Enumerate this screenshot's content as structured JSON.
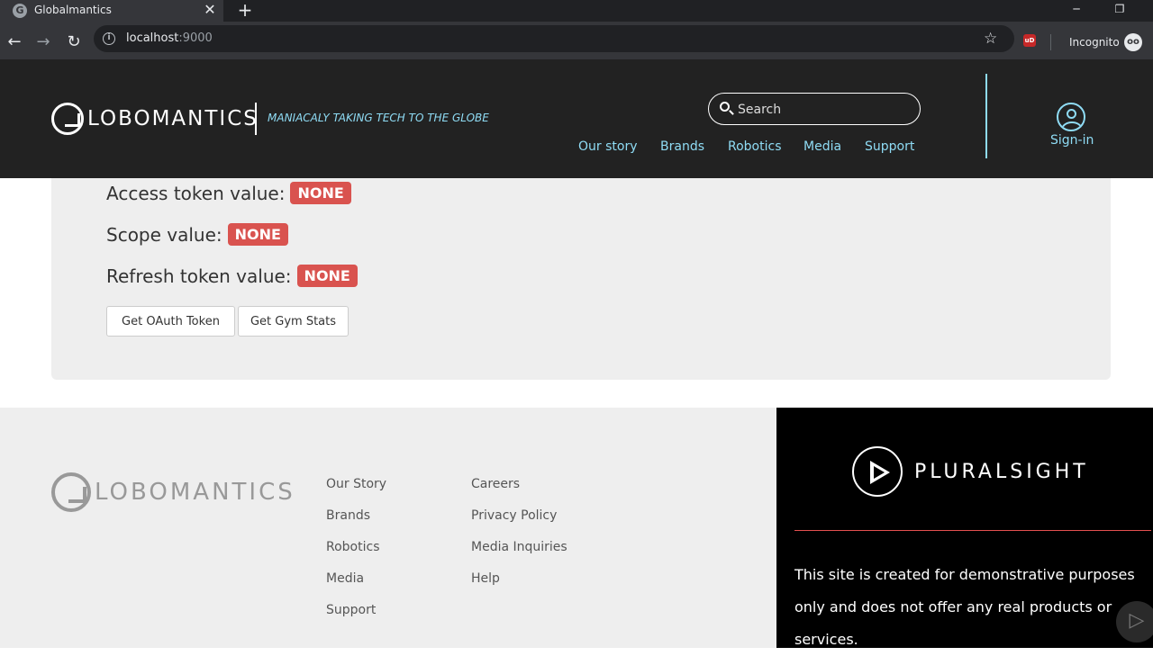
{
  "browser": {
    "tab_title": "Globalmantics",
    "tab_close": "✕",
    "new_tab": "+",
    "url_host": "localhost",
    "url_port": ":9000",
    "incognito_label": "Incognito",
    "ext_label": "uD"
  },
  "header": {
    "logo_text": "LOBOMANTICS",
    "tagline": "MANIACALY TAKING TECH TO THE GLOBE",
    "search_placeholder": "Search",
    "nav": [
      "Our story",
      "Brands",
      "Robotics",
      "Media",
      "Support"
    ],
    "signin": "Sign-in"
  },
  "panel": {
    "rows": [
      {
        "label": "Access token value:",
        "badge": "NONE"
      },
      {
        "label": "Scope value:",
        "badge": "NONE"
      },
      {
        "label": "Refresh token value:",
        "badge": "NONE"
      }
    ],
    "buttons": [
      "Get OAuth Token",
      "Get Gym Stats"
    ]
  },
  "footer": {
    "logo_text": "LOBOMANTICS",
    "col1": [
      "Our Story",
      "Brands",
      "Robotics",
      "Media",
      "Support"
    ],
    "col2": [
      "Careers",
      "Privacy Policy",
      "Media Inquiries",
      "Help"
    ]
  },
  "pluralsight": {
    "name": "PLURALSIGHT",
    "disclaimer": "This site is created for demonstrative purposes only and does not offer any real products or services."
  },
  "colors": {
    "header_bg": "#222222",
    "accent": "#8fdcf5",
    "badge": "#d9534f"
  }
}
